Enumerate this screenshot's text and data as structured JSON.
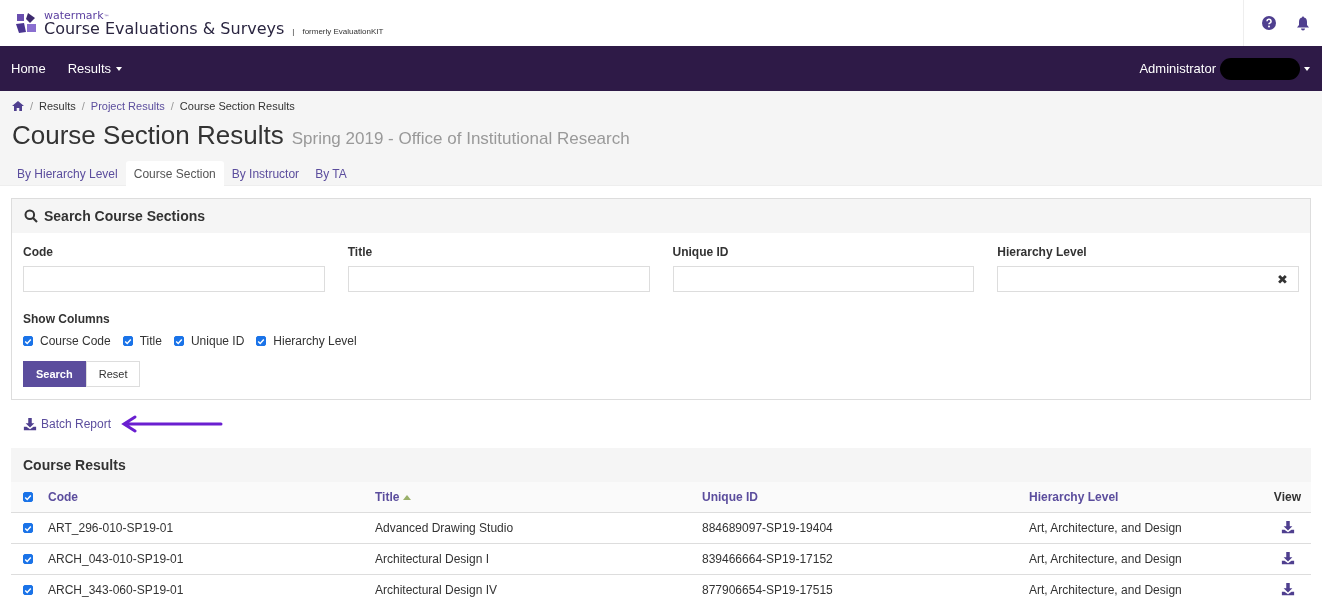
{
  "brand": {
    "superscript": "watermark",
    "tm": "™",
    "name": "Course Evaluations & Surveys",
    "separator": "|",
    "former": "formerly EvaluationKIT"
  },
  "nav": {
    "items": [
      {
        "label": "Home",
        "dropdown": false
      },
      {
        "label": "Results",
        "dropdown": true
      }
    ],
    "user": "Administrator"
  },
  "breadcrumb_separator": "/",
  "breadcrumb": [
    {
      "label": "Results",
      "link": false
    },
    {
      "label": "Project Results",
      "link": true
    },
    {
      "label": "Course Section Results",
      "link": false
    }
  ],
  "page": {
    "title": "Course Section Results",
    "subtitle": "Spring 2019 - Office of Institutional Research"
  },
  "tabs": [
    {
      "label": "By Hierarchy Level",
      "selected": false
    },
    {
      "label": "Course Section",
      "selected": true
    },
    {
      "label": "By Instructor",
      "selected": false
    },
    {
      "label": "By TA",
      "selected": false
    }
  ],
  "search": {
    "title": "Search Course Sections",
    "fields": [
      {
        "label": "Code"
      },
      {
        "label": "Title"
      },
      {
        "label": "Unique ID"
      },
      {
        "label": "Hierarchy Level",
        "clear": "✖"
      }
    ],
    "show_columns": {
      "label": "Show Columns",
      "options": [
        {
          "label": "Course Code",
          "checked": true
        },
        {
          "label": "Title",
          "checked": true
        },
        {
          "label": "Unique ID",
          "checked": true
        },
        {
          "label": "Hierarchy Level",
          "checked": true
        }
      ]
    },
    "buttons": [
      {
        "label": "Search",
        "primary": true
      },
      {
        "label": "Reset",
        "primary": false
      }
    ]
  },
  "batch_report": {
    "label": "Batch Report"
  },
  "results": {
    "title": "Course Results",
    "all_checked": true,
    "columns": [
      {
        "label": "Code",
        "sortable": true,
        "sorted_ascending": false
      },
      {
        "label": "Title",
        "sortable": true,
        "sorted_ascending": true
      },
      {
        "label": "Unique ID",
        "sortable": true,
        "sorted_ascending": false
      },
      {
        "label": "Hierarchy Level",
        "sortable": true,
        "sorted_ascending": false
      },
      {
        "label": "View",
        "sortable": false,
        "sorted_ascending": false
      }
    ],
    "rows": [
      {
        "checked": true,
        "code": "ART_296-010-SP19-01",
        "title": "Advanced Drawing Studio",
        "unique_id": "884689097-SP19-19404",
        "hierarchy": "Art, Architecture, and Design"
      },
      {
        "checked": true,
        "code": "ARCH_043-010-SP19-01",
        "title": "Architectural Design I",
        "unique_id": "839466664-SP19-17152",
        "hierarchy": "Art, Architecture, and Design"
      },
      {
        "checked": true,
        "code": "ARCH_343-060-SP19-01",
        "title": "Architectural Design IV",
        "unique_id": "877906654-SP19-17515",
        "hierarchy": "Art, Architecture, and Design"
      }
    ]
  }
}
